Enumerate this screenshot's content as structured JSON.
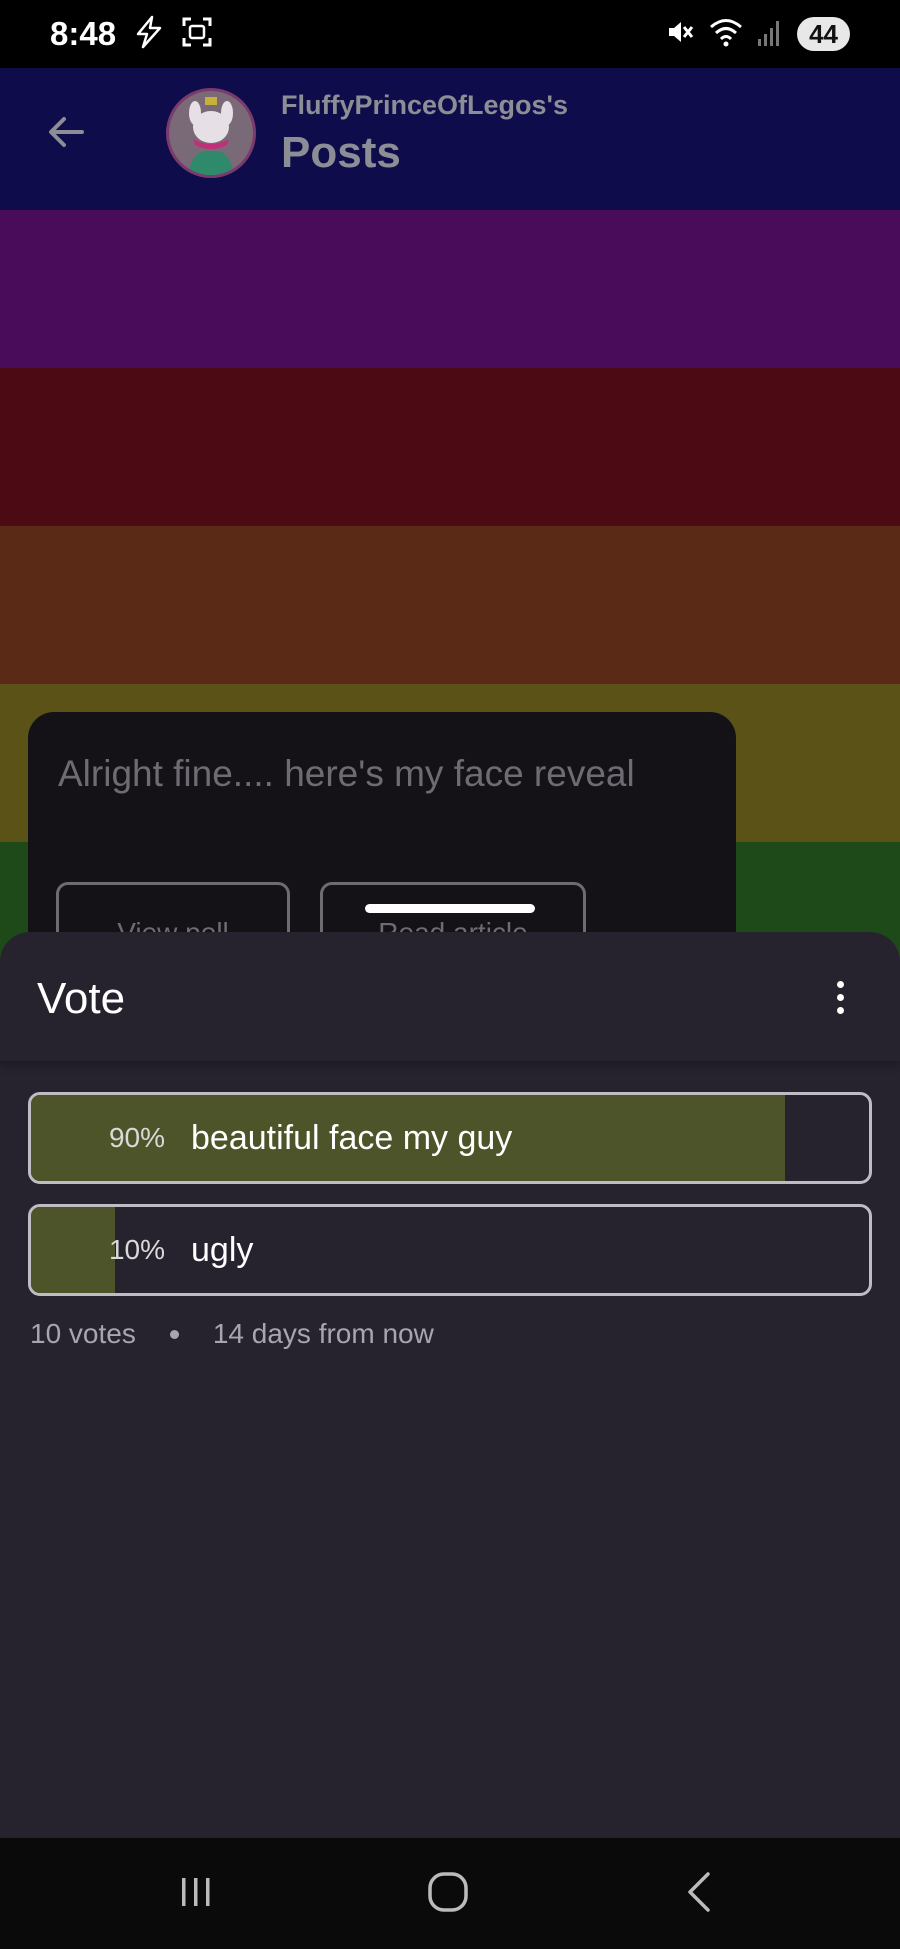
{
  "status_bar": {
    "time": "8:48",
    "battery": "44",
    "left_icons": [
      "flash-icon",
      "screenshot-icon"
    ],
    "right_icons": [
      "mute-icon",
      "wifi-icon",
      "signal-icon"
    ]
  },
  "header": {
    "subtitle": "FluffyPrinceOfLegos's",
    "title": "Posts"
  },
  "post": {
    "text": "Alright fine.... here's my face reveal",
    "buttons": [
      "View poll",
      "Read article"
    ]
  },
  "sheet": {
    "title": "Vote",
    "options": [
      {
        "label": "beautiful face my guy",
        "percent": "90%",
        "fraction": 0.9
      },
      {
        "label": "ugly",
        "percent": "10%",
        "fraction": 0.1
      }
    ],
    "votes": "10 votes",
    "deadline": "14 days from now"
  },
  "colors": {
    "sheet_bg": "#26232f",
    "option_fill": "#4e5429",
    "option_border": "#bfbcc4"
  }
}
